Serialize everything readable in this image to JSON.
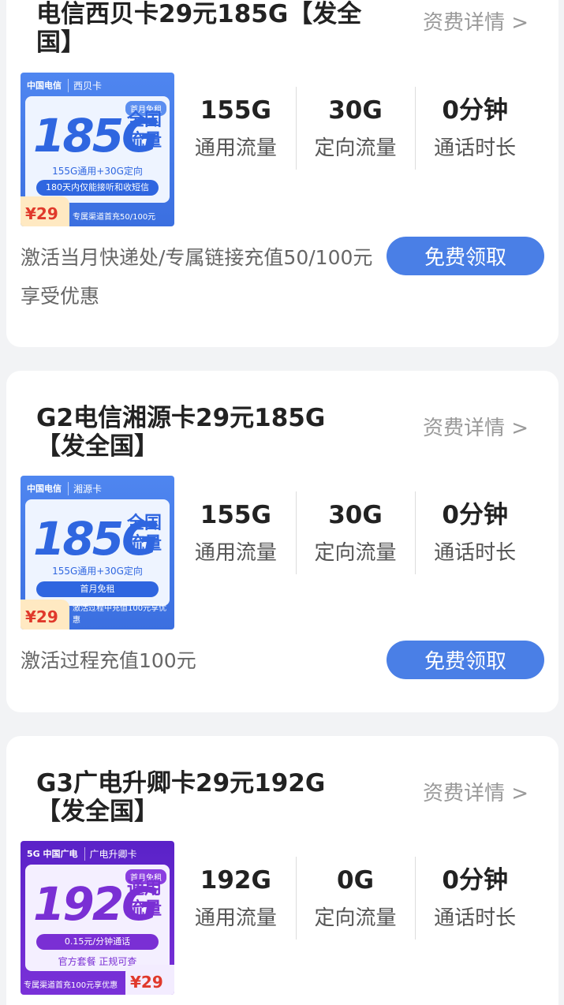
{
  "cards": [
    {
      "title": "电信西贝卡29元185G【发全国】",
      "detail": "资费详情 >",
      "stats": [
        {
          "value": "155G",
          "label": "通用流量"
        },
        {
          "value": "30G",
          "label": "定向流量"
        },
        {
          "value": "0分钟",
          "label": "通话时长"
        }
      ],
      "note": "激活当月快递处/专属链接充值50/100元享受优惠",
      "button": "免费领取",
      "thumb": {
        "logo": "中国电信",
        "card_name": "西贝卡",
        "tag": "首月免租",
        "big": "185G",
        "side": "全国流量",
        "sub": "155G通用+30G定向",
        "pill": "180天内仅能接听和收短信",
        "price": "¥29",
        "promo": "专属渠道首充50/100元"
      }
    },
    {
      "title": "G2电信湘源卡29元185G【发全国】",
      "detail": "资费详情 >",
      "stats": [
        {
          "value": "155G",
          "label": "通用流量"
        },
        {
          "value": "30G",
          "label": "定向流量"
        },
        {
          "value": "0分钟",
          "label": "通话时长"
        }
      ],
      "note": "激活过程充值100元",
      "button": "免费领取",
      "thumb": {
        "logo": "中国电信",
        "card_name": "湘源卡",
        "big": "185G",
        "side": "全国流量",
        "sub": "155G通用+30G定向",
        "pill": "首月免租",
        "price": "¥29",
        "promo": "激活过程中充值100元享优惠"
      }
    },
    {
      "title": "G3广电升卿卡29元192G【发全国】",
      "detail": "资费详情 >",
      "stats": [
        {
          "value": "192G",
          "label": "通用流量"
        },
        {
          "value": "0G",
          "label": "定向流量"
        },
        {
          "value": "0分钟",
          "label": "通话时长"
        }
      ],
      "note": "",
      "button": "",
      "thumb": {
        "logo": "5G 中国广电",
        "card_name": "广电升卿卡",
        "tag": "首月免租",
        "big": "192G",
        "side": "通用流量",
        "pill": "0.15元/分钟通话",
        "sub": "官方套餐 正规可查",
        "price": "¥29",
        "promo": "专属渠道首充100元享优惠"
      }
    }
  ]
}
